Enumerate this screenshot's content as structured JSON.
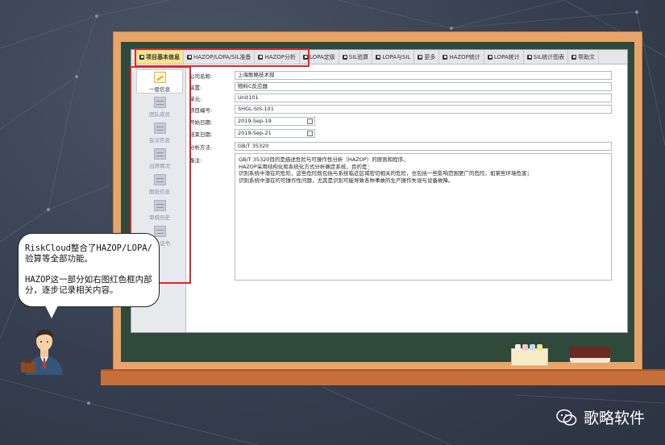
{
  "tabs": [
    {
      "label": "项目基本信息",
      "active": true
    },
    {
      "label": "HAZOP/LOPA/SIL准备",
      "active": false
    },
    {
      "label": "HAZOP分析",
      "active": false
    },
    {
      "label": "LOPA定级",
      "active": false
    },
    {
      "label": "SIL验算",
      "active": false
    },
    {
      "label": "LOPA与SIL",
      "active": false
    },
    {
      "label": "更多",
      "active": false
    },
    {
      "label": "HAZOP统计",
      "active": false
    },
    {
      "label": "LOPA统计",
      "active": false
    },
    {
      "label": "SIL统计图表",
      "active": false
    },
    {
      "label": "帮助文",
      "active": false
    }
  ],
  "sidebar": {
    "items": [
      {
        "label": "一般信息",
        "active": true
      },
      {
        "label": "团队成员",
        "active": false
      },
      {
        "label": "会议信息",
        "active": false
      },
      {
        "label": "出席情况",
        "active": false
      },
      {
        "label": "图纸信息",
        "active": false
      },
      {
        "label": "审核历史",
        "active": false
      },
      {
        "label": "电子证书",
        "active": false
      }
    ]
  },
  "form": {
    "company_label": "公司名称:",
    "company_value": "上海歌略技术部",
    "device_label": "装置:",
    "device_value": "物料C反应器",
    "unit_label": "单元:",
    "unit_value": "Unit101",
    "project_no_label": "项目编号:",
    "project_no_value": "SHGL-SIS-101",
    "start_label": "开始日期:",
    "start_value": "2019-Sep-19",
    "end_label": "结束日期:",
    "end_value": "2019-Sep-21",
    "method_label": "分析方法:",
    "method_value": "GB/T 35320",
    "notes_label": "备注:",
    "notes_lines": [
      "GB/T 35320目的是描述危险与可操作性分析（HAZOP）的原则和程序。",
      "HAZOP采用结构化和系统化方式分析确定系统，目的是：",
      "识别系统中潜在的危险，这些危险既包括与系统临近区域密切相关的危险，也包括一些影响范围更广的危险，如某些环境危害；",
      "识别系统中潜在的可操作性问题，尤其是识别可能导致各种事故的生产操作失误与设备故障。"
    ]
  },
  "bubble": {
    "text": "RiskCloud整合了HAZOP/LOPA/验算等全部功能。\n\nHAZOP这一部分如右图红色框内部分，逐步记录相关内容。"
  },
  "brand": {
    "name": "歌略软件"
  },
  "colors": {
    "highlight": "#e0262a",
    "active_tab": "#f9e48d",
    "board": "#2f4a3a",
    "frame": "#e9a46a"
  }
}
